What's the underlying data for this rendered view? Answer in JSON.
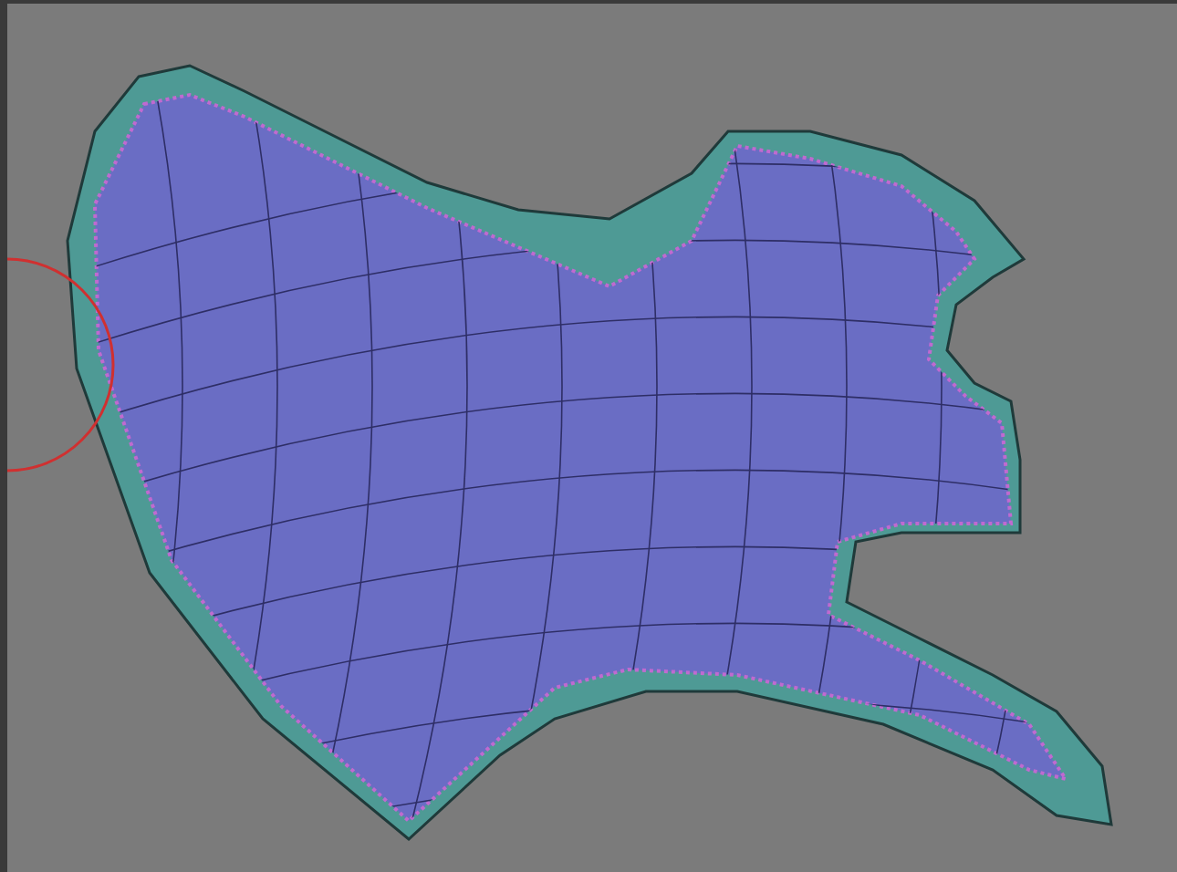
{
  "viewport": {
    "objects": [
      {
        "kind": "mesh"
      },
      {
        "kind": "gizmo"
      }
    ]
  }
}
